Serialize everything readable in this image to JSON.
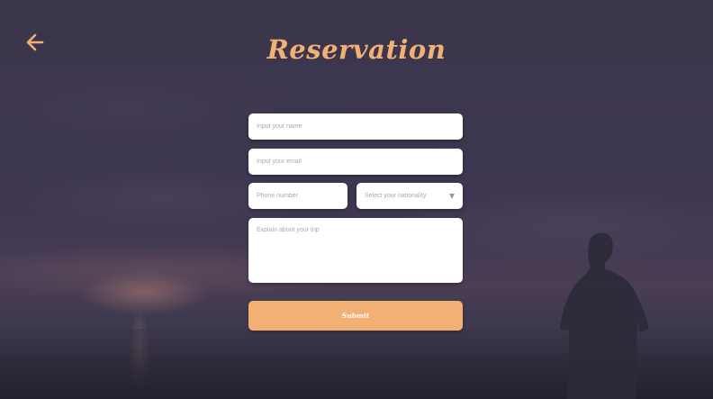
{
  "header": {
    "title": "Reservation",
    "back_icon": "arrow-left-icon"
  },
  "form": {
    "name_placeholder": "Input your name",
    "email_placeholder": "Input your email",
    "phone_placeholder": "Phone number",
    "nationality_placeholder": "Select your nationality",
    "nationality_icon": "triangle-down-icon",
    "trip_placeholder": "Explain about your trip",
    "submit_label": "Submit"
  },
  "colors": {
    "accent": "#f2b074",
    "background": "#3c364c",
    "field_background": "#ffffff"
  }
}
